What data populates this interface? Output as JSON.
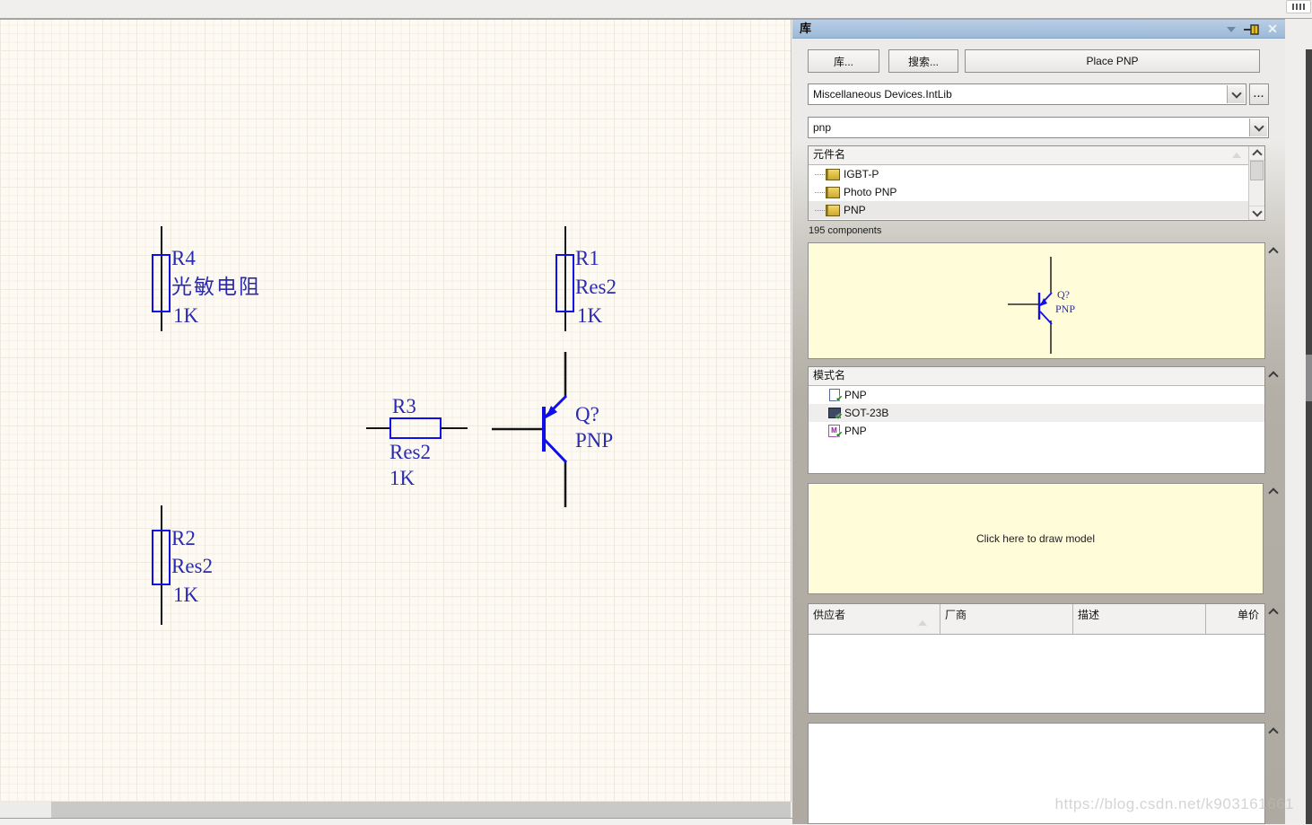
{
  "browser": {
    "watermark": "https://blog.csdn.net/k903161661"
  },
  "window": {
    "top_right_button_icon": "panels-icon"
  },
  "panel": {
    "title": "库",
    "titlebar_icons": [
      "chevron-down-icon",
      "pin-icon",
      "close-icon"
    ],
    "buttons": {
      "libraries": "库...",
      "search": "搜索...",
      "place": "Place PNP",
      "more": "..."
    },
    "library_dropdown": {
      "value": "Miscellaneous Devices.IntLib"
    },
    "filter_dropdown": {
      "value": "pnp"
    },
    "component_list": {
      "header": "元件名",
      "items": [
        {
          "name": "IGBT-P",
          "icon": "component-chip-icon"
        },
        {
          "name": "Photo PNP",
          "icon": "component-chip-icon"
        },
        {
          "name": "PNP",
          "icon": "component-chip-icon",
          "selected": true
        }
      ],
      "count_text": "195 components"
    },
    "preview": {
      "designator": "Q?",
      "type": "PNP"
    },
    "model_list": {
      "header": "模式名",
      "items": [
        {
          "name": "PNP",
          "icon": "simulation-file-icon"
        },
        {
          "name": "SOT-23B",
          "icon": "footprint-icon",
          "selected": true
        },
        {
          "name": "PNP",
          "icon": "sim-model-icon"
        }
      ]
    },
    "model_preview": {
      "placeholder": "Click here to draw model"
    },
    "supplier_table": {
      "columns": [
        "供应者",
        "厂商",
        "描述",
        "单价"
      ]
    }
  },
  "schematic": {
    "r4": {
      "designator": "R4",
      "comment": "光敏电阻",
      "value": "1K"
    },
    "r1": {
      "designator": "R1",
      "comment": "Res2",
      "value": "1K"
    },
    "r3": {
      "designator": "R3",
      "comment": "Res2",
      "value": "1K"
    },
    "r2": {
      "designator": "R2",
      "comment": "Res2",
      "value": "1K"
    },
    "q1": {
      "designator": "Q?",
      "comment": "PNP"
    }
  },
  "colors": {
    "schematic_symbol": "#0f0fe8",
    "schematic_text": "#2b2bae",
    "titlebar": "#a6c1dd",
    "preview_bg": "#fffcda",
    "canvas_bg": "#fdfaf3"
  }
}
